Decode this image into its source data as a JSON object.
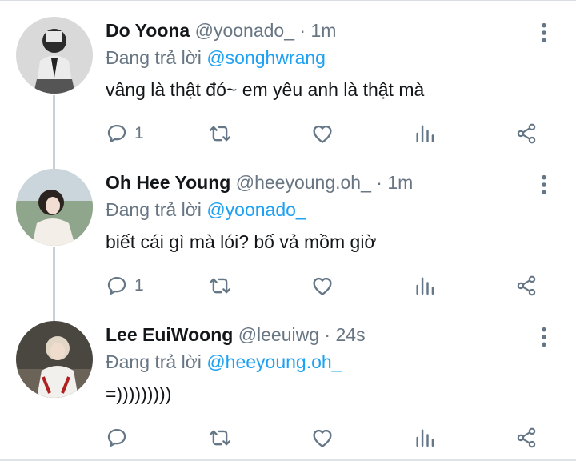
{
  "colors": {
    "accent": "#1da1f2",
    "secondary_text": "#687684",
    "icon": "#657786",
    "thread_line": "#c9d1d7"
  },
  "tweets": [
    {
      "name": "Do Yoona",
      "handle": "@yoonado_",
      "dot": "·",
      "time": "1m",
      "replying_prefix": "Đang trả lời",
      "replying_to": "@songhwrang",
      "text": "vâng là thật đó~ em yêu anh là thật mà",
      "reply_count": "1",
      "icons": [
        "reply-icon",
        "retweet-icon",
        "like-icon",
        "analytics-icon",
        "share-icon",
        "more-icon"
      ]
    },
    {
      "name": "Oh Hee Young",
      "handle": "@heeyoung.oh_",
      "dot": "·",
      "time": "1m",
      "replying_prefix": "Đang trả lời",
      "replying_to": "@yoonado_",
      "text": "biết cái gì mà lói? bố vả mồm giờ",
      "reply_count": "1",
      "icons": [
        "reply-icon",
        "retweet-icon",
        "like-icon",
        "analytics-icon",
        "share-icon",
        "more-icon"
      ]
    },
    {
      "name": "Lee EuiWoong",
      "handle": "@leeuiwg",
      "dot": "·",
      "time": "24s",
      "replying_prefix": "Đang trả lời",
      "replying_to": "@heeyoung.oh_",
      "text": "=)))))))))",
      "reply_count": "",
      "icons": [
        "reply-icon",
        "retweet-icon",
        "like-icon",
        "analytics-icon",
        "share-icon",
        "more-icon"
      ]
    }
  ]
}
